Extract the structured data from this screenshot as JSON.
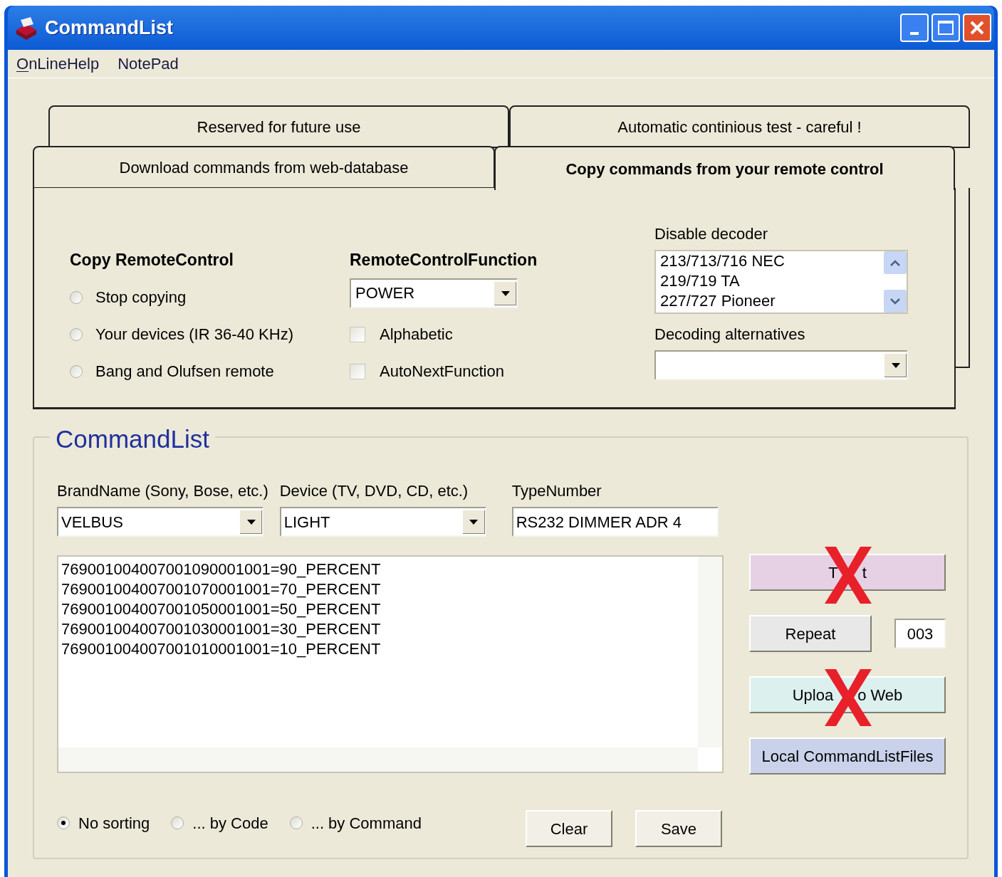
{
  "window": {
    "title": "CommandList"
  },
  "menu": [
    {
      "mnemonic": "O",
      "rest": "nLineHelp"
    },
    {
      "label": "NotePad"
    }
  ],
  "tabs_back": [
    {
      "label": "Reserved for future use",
      "selected": false
    },
    {
      "label": "Automatic continious test - careful !",
      "selected": false
    }
  ],
  "tabs_front": [
    {
      "label": "Download commands from web-database",
      "selected": false
    },
    {
      "label": "Copy commands from your remote control",
      "selected": true
    }
  ],
  "copy_remote": {
    "heading": "Copy RemoteControl",
    "options": [
      {
        "label": "Stop copying",
        "selected": false
      },
      {
        "label": "Your devices (IR 36-40 KHz)",
        "selected": false
      },
      {
        "label": "Bang and Olufsen remote",
        "selected": false
      }
    ]
  },
  "remote_function": {
    "heading": "RemoteControlFunction",
    "value": "POWER",
    "checkboxes": [
      {
        "label": "Alphabetic",
        "checked": false
      },
      {
        "label": "AutoNextFunction",
        "checked": false
      }
    ]
  },
  "disable_decoder": {
    "label": "Disable decoder",
    "items": [
      "213/713/716 NEC",
      "219/719 TA",
      "227/727 Pioneer"
    ]
  },
  "decoding_alternatives": {
    "label": "Decoding alternatives"
  },
  "commandlist": {
    "title": "CommandList",
    "fields": [
      {
        "label": "BrandName (Sony, Bose, etc.)",
        "value": "VELBUS",
        "kind": "combo"
      },
      {
        "label": "Device (TV, DVD, CD, etc.)",
        "value": "LIGHT",
        "kind": "combo"
      },
      {
        "label": "TypeNumber",
        "value": "RS232 DIMMER ADR 4",
        "kind": "text"
      }
    ],
    "lines": [
      "769001004007001090001001=90_PERCENT",
      "769001004007001070001001=70_PERCENT",
      "769001004007001050001001=50_PERCENT",
      "769001004007001030001001=30_PERCENT",
      "769001004007001010001001=10_PERCENT"
    ],
    "buttons": [
      {
        "parts": [
          "T",
          "t"
        ],
        "color": "#e6d1e4",
        "crossed": true,
        "kind": "wide"
      },
      {
        "parts": [
          "Repeat"
        ],
        "color": "#e8e8e8",
        "crossed": false,
        "kind": "repeat",
        "count": "003"
      },
      {
        "parts": [
          "Uploa",
          "o Web"
        ],
        "color": "#dcf0ee",
        "crossed": true,
        "kind": "wide"
      },
      {
        "parts": [
          "Local CommandListFiles"
        ],
        "color": "#c9d2ea",
        "crossed": false,
        "kind": "wide"
      }
    ],
    "sorting": [
      {
        "label": "No sorting",
        "selected": true
      },
      {
        "label": "... by Code",
        "selected": false
      },
      {
        "label": "... by Command",
        "selected": false
      }
    ],
    "actions": [
      "Clear",
      "Save"
    ]
  }
}
